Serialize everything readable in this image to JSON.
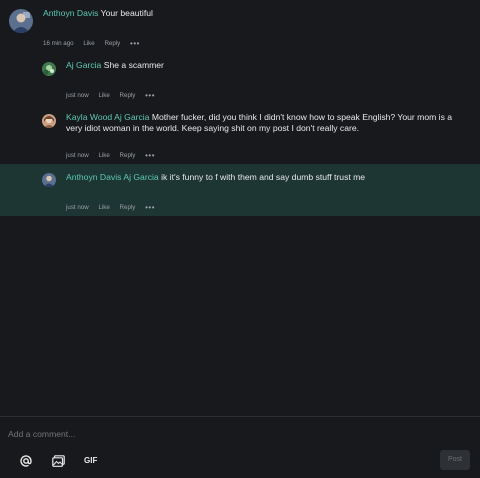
{
  "comments": [
    {
      "author": "Anthoyn Davis",
      "mention": "",
      "body": "Your beautiful",
      "time": "16 min ago",
      "like": "Like",
      "reply": "Reply",
      "more": "•••",
      "avatar": "avatar-davis"
    },
    {
      "author": "Aj Garcia",
      "mention": "",
      "body": "She a scammer",
      "time": "just now",
      "like": "Like",
      "reply": "Reply",
      "more": "•••",
      "avatar": "avatar-garcia"
    },
    {
      "author": "Kayla Wood",
      "mention": "Aj Garcia",
      "body": "Mother fucker, did you think I didn't know how to speak English? Your mom is a very idiot woman in the world. Keep saying shit on my post I don't really care.",
      "time": "just now",
      "like": "Like",
      "reply": "Reply",
      "more": "•••",
      "avatar": "avatar-wood"
    },
    {
      "author": "Anthoyn Davis",
      "mention": "Aj Garcia",
      "body": "ik it's funny to f with them and say dumb stuff trust me",
      "time": "just now",
      "like": "Like",
      "reply": "Reply",
      "more": "•••",
      "avatar": "avatar-davis"
    }
  ],
  "composer": {
    "placeholder": "Add a comment...",
    "mention_icon": "at-icon",
    "image_icon": "image-upload-icon",
    "gif_label": "GIF",
    "post_label": "Post"
  },
  "colors": {
    "name": "#5fc8b3",
    "highlight": "#1d3533",
    "background": "#17191c"
  }
}
